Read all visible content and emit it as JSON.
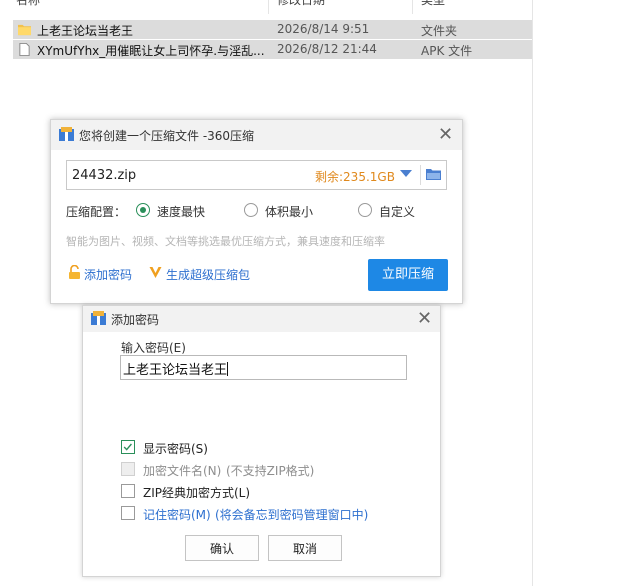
{
  "explorer": {
    "headers": {
      "name": "名称",
      "date": "修改日期",
      "type": "类型"
    },
    "files": [
      {
        "name": "上老王论坛当老王",
        "date": "2026/8/14 9:51",
        "type": "文件夹",
        "icon": "folder-icon"
      },
      {
        "name": "XYmUfYhx_用催眠让女上司怀孕.与淫乱...",
        "date": "2026/8/12 21:44",
        "type": "APK 文件",
        "icon": "file-icon"
      }
    ]
  },
  "compress_dialog": {
    "title": "您将创建一个压缩文件 -360压缩",
    "archive_name": "24432.zip",
    "free_space": "剩余:235.1GB",
    "config_label": "压缩配置：",
    "options": [
      {
        "label": "速度最快",
        "selected": true
      },
      {
        "label": "体积最小",
        "selected": false
      },
      {
        "label": "自定义",
        "selected": false
      }
    ],
    "hint": "智能为图片、视频、文档等挑选最优压缩方式，兼具速度和压缩率",
    "add_password": "添加密码",
    "super_archive": "生成超级压缩包",
    "compress_now": "立即压缩",
    "accent": "#1e88e5"
  },
  "password_dialog": {
    "title": "添加密码",
    "input_label": "输入密码(E)",
    "password_value": "上老王论坛当老王",
    "options": [
      {
        "label": "显示密码(S)",
        "checked": true,
        "disabled": false,
        "note": ""
      },
      {
        "label": "加密文件名(N)",
        "checked": false,
        "disabled": true,
        "note": "(不支持ZIP格式)"
      },
      {
        "label": "ZIP经典加密方式(L)",
        "checked": false,
        "disabled": false,
        "note": ""
      },
      {
        "label": "记住密码(M)",
        "checked": false,
        "disabled": false,
        "note": "(将会备忘到密码管理窗口中)"
      }
    ],
    "ok": "确认",
    "cancel": "取消"
  }
}
